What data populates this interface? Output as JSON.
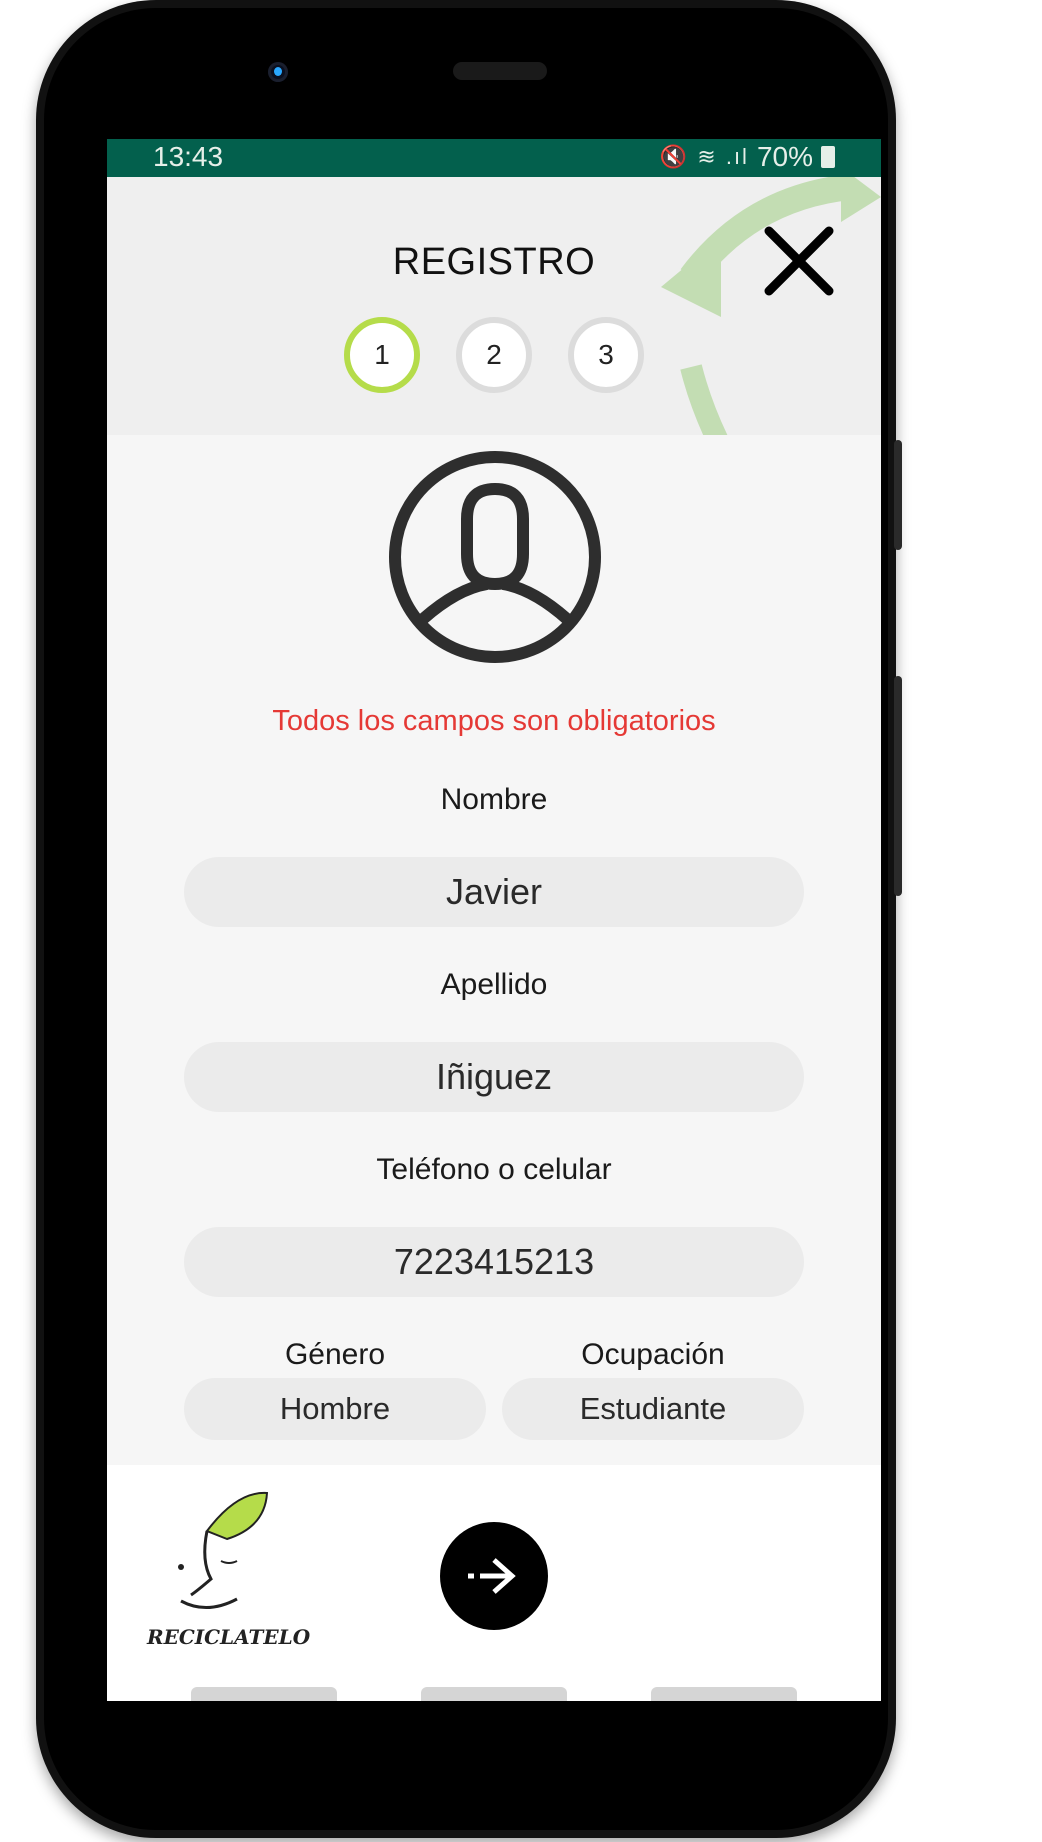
{
  "statusbar": {
    "time": "13:43",
    "icons": "🔇 ≋ .ıl",
    "battery": "70%"
  },
  "header": {
    "title": "REGISTRO",
    "close_icon": "close-icon",
    "steps": [
      "1",
      "2",
      "3"
    ],
    "active_step": 1,
    "accent_color": "#b5dc4a"
  },
  "form": {
    "required_note": "Todos los campos son obligatorios",
    "first_name": {
      "label": "Nombre",
      "value": "Javier"
    },
    "last_name": {
      "label": "Apellido",
      "value": "Iñiguez"
    },
    "phone": {
      "label": "Teléfono o celular",
      "value": "7223415213"
    },
    "gender": {
      "label": "Género",
      "value": "Hombre"
    },
    "occupation": {
      "label": "Ocupación",
      "value": "Estudiante"
    }
  },
  "footer": {
    "logo_text": "RECICLATELO",
    "next_icon": "arrow-right-icon"
  },
  "colors": {
    "statusbar": "#03604d",
    "error_text": "#e53935",
    "field_bg": "#ebebeb"
  }
}
